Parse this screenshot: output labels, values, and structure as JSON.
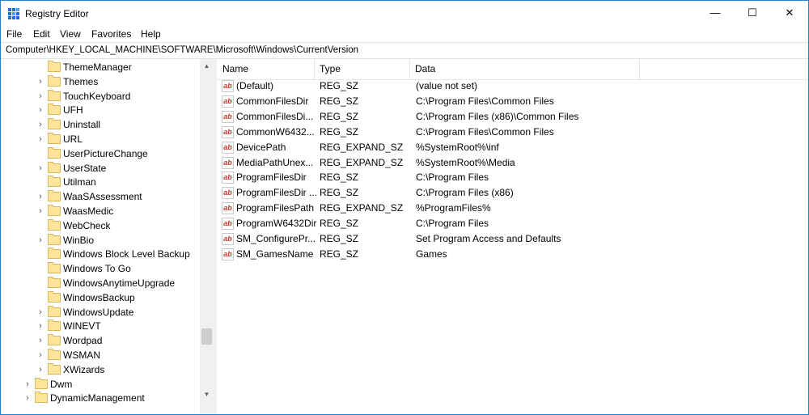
{
  "window": {
    "title": "Registry Editor",
    "minimize": "—",
    "maximize": "☐",
    "close": "✕"
  },
  "menu": [
    "File",
    "Edit",
    "View",
    "Favorites",
    "Help"
  ],
  "address": "Computer\\HKEY_LOCAL_MACHINE\\SOFTWARE\\Microsoft\\Windows\\CurrentVersion",
  "tree": [
    {
      "label": "ThemeManager",
      "expandable": false
    },
    {
      "label": "Themes",
      "expandable": true
    },
    {
      "label": "TouchKeyboard",
      "expandable": true
    },
    {
      "label": "UFH",
      "expandable": true
    },
    {
      "label": "Uninstall",
      "expandable": true
    },
    {
      "label": "URL",
      "expandable": true
    },
    {
      "label": "UserPictureChange",
      "expandable": false
    },
    {
      "label": "UserState",
      "expandable": true
    },
    {
      "label": "Utilman",
      "expandable": false
    },
    {
      "label": "WaaSAssessment",
      "expandable": true
    },
    {
      "label": "WaasMedic",
      "expandable": true
    },
    {
      "label": "WebCheck",
      "expandable": false
    },
    {
      "label": "WinBio",
      "expandable": true
    },
    {
      "label": "Windows Block Level Backup",
      "expandable": false
    },
    {
      "label": "Windows To Go",
      "expandable": false
    },
    {
      "label": "WindowsAnytimeUpgrade",
      "expandable": false
    },
    {
      "label": "WindowsBackup",
      "expandable": false
    },
    {
      "label": "WindowsUpdate",
      "expandable": true
    },
    {
      "label": "WINEVT",
      "expandable": true
    },
    {
      "label": "Wordpad",
      "expandable": true
    },
    {
      "label": "WSMAN",
      "expandable": true
    },
    {
      "label": "XWizards",
      "expandable": true
    },
    {
      "label": "Dwm",
      "expandable": true,
      "level": 0
    },
    {
      "label": "DynamicManagement",
      "expandable": true,
      "level": 0
    }
  ],
  "columns": [
    "Name",
    "Type",
    "Data"
  ],
  "values": [
    {
      "name": "(Default)",
      "type": "REG_SZ",
      "data": "(value not set)"
    },
    {
      "name": "CommonFilesDir",
      "type": "REG_SZ",
      "data": "C:\\Program Files\\Common Files"
    },
    {
      "name": "CommonFilesDi...",
      "type": "REG_SZ",
      "data": "C:\\Program Files (x86)\\Common Files"
    },
    {
      "name": "CommonW6432...",
      "type": "REG_SZ",
      "data": "C:\\Program Files\\Common Files"
    },
    {
      "name": "DevicePath",
      "type": "REG_EXPAND_SZ",
      "data": "%SystemRoot%\\inf"
    },
    {
      "name": "MediaPathUnex...",
      "type": "REG_EXPAND_SZ",
      "data": "%SystemRoot%\\Media"
    },
    {
      "name": "ProgramFilesDir",
      "type": "REG_SZ",
      "data": "C:\\Program Files"
    },
    {
      "name": "ProgramFilesDir ...",
      "type": "REG_SZ",
      "data": "C:\\Program Files (x86)"
    },
    {
      "name": "ProgramFilesPath",
      "type": "REG_EXPAND_SZ",
      "data": "%ProgramFiles%"
    },
    {
      "name": "ProgramW6432Dir",
      "type": "REG_SZ",
      "data": "C:\\Program Files"
    },
    {
      "name": "SM_ConfigurePr...",
      "type": "REG_SZ",
      "data": "Set Program Access and Defaults"
    },
    {
      "name": "SM_GamesName",
      "type": "REG_SZ",
      "data": "Games"
    }
  ],
  "icons": {
    "app": "registry-icon",
    "value": "string-value-icon",
    "folder": "folder-icon"
  },
  "colors": {
    "accent": "#1883d7",
    "folder": "#ffe49c"
  }
}
